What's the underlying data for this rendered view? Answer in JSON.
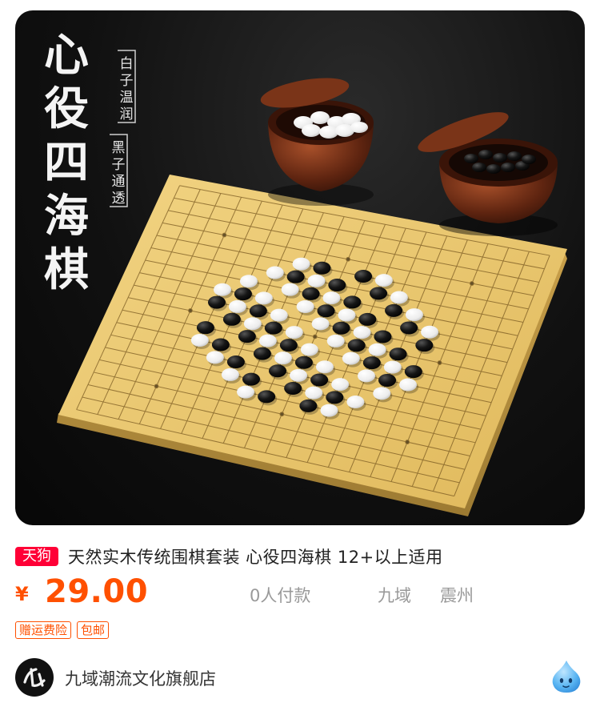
{
  "product": {
    "image": {
      "overlay_title": "心役四海棋",
      "tag_white": "白子温润",
      "tag_black": "黑子通透"
    },
    "brand_badge": "天狗",
    "title": "天然实木传统围棋套装 心役四海棋 12+以上适用",
    "currency": "¥",
    "price": "29.00",
    "sales": "0人付款",
    "location_province": "九域",
    "location_city": "震州",
    "tags": [
      "赠运费险",
      "包邮"
    ]
  },
  "shop": {
    "name": "九域潮流文化旗舰店",
    "logo_icon": "calligraphy-logo-icon",
    "mascot_icon": "water-drop-mascot-icon"
  },
  "colors": {
    "accent": "#ff5000",
    "brand_badge": "#ff0036",
    "board": "#e8c66a"
  }
}
